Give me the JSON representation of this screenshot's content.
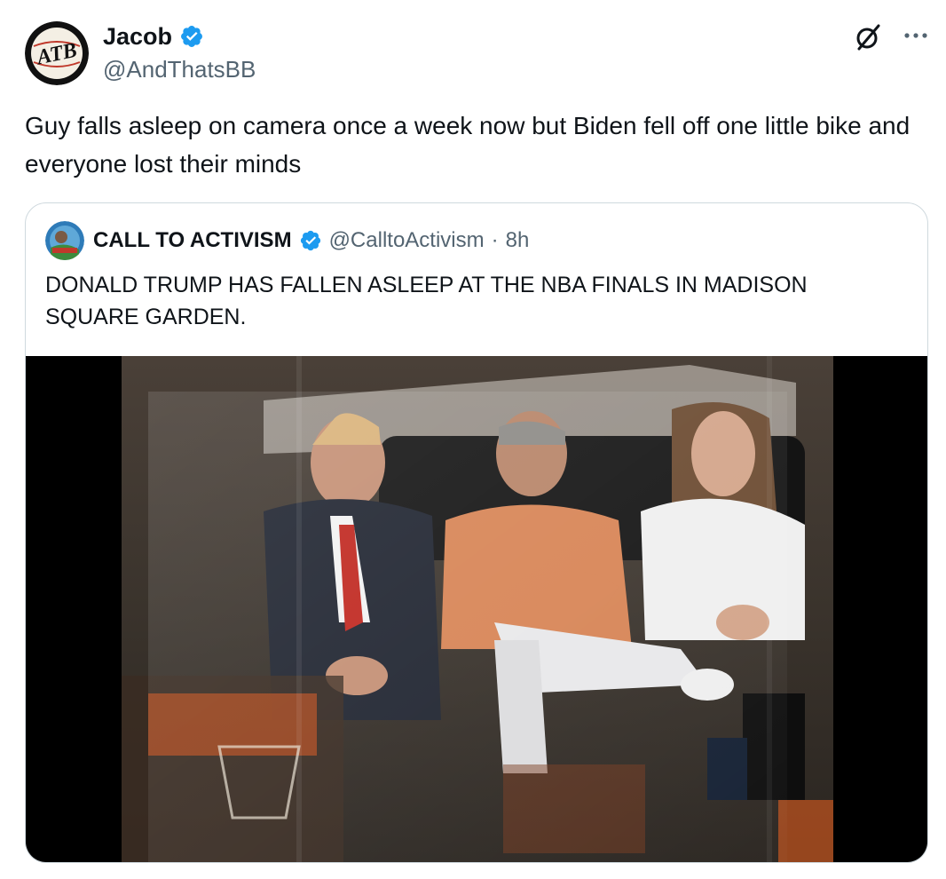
{
  "tweet": {
    "author": {
      "display_name": "Jacob",
      "handle": "@AndThatsBB",
      "verified": true,
      "avatar_logo_text": "ATB"
    },
    "text": "Guy falls asleep on camera once a week now but Biden fell off one little bike and everyone lost their minds",
    "icons": {
      "grok": "grok-icon",
      "more": "more-icon",
      "verified": "verified-badge-icon"
    }
  },
  "quoted_tweet": {
    "author": {
      "display_name": "CALL TO ACTIVISM",
      "handle": "@CalltoActivism",
      "verified": true
    },
    "separator": "·",
    "time": "8h",
    "text": "DONALD TRUMP HAS FALLEN ASLEEP AT THE NBA FINALS IN MADISON SQUARE GARDEN.",
    "media": {
      "type": "video"
    }
  },
  "colors": {
    "text_primary": "#0f1419",
    "text_secondary": "#536471",
    "verified_blue": "#1d9bf0",
    "card_border": "#cfd9de"
  }
}
